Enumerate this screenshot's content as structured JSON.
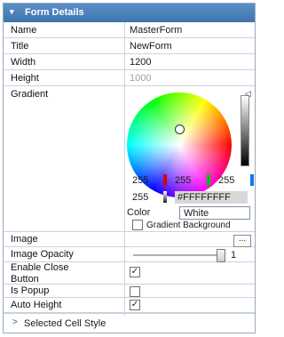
{
  "header": {
    "title": "Form Details",
    "chevron": "▾"
  },
  "rows": {
    "name": {
      "label": "Name",
      "value": "MasterForm"
    },
    "title": {
      "label": "Title",
      "value": "NewForm"
    },
    "width": {
      "label": "Width",
      "value": "1200"
    },
    "height": {
      "label": "Height",
      "value": "1000"
    },
    "gradient": {
      "label": "Gradient"
    },
    "image": {
      "label": "Image",
      "browse": "..."
    },
    "image_opacity": {
      "label": "Image Opacity",
      "value": "1"
    },
    "enable_close": {
      "label": "Enable Close Button",
      "checked": true
    },
    "is_popup": {
      "label": "Is Popup",
      "checked": false
    },
    "auto_height": {
      "label": "Auto Height",
      "checked": true
    }
  },
  "color_picker": {
    "r1": "255",
    "g1": "255",
    "b1": "255",
    "a": "255",
    "hex": "#FFFFFFFF",
    "color_label": "Color",
    "color_value": "White",
    "gradient_background_label": "Gradient Background",
    "gradient_background_checked": false,
    "swatch_red": "#e00000",
    "swatch_green": "#00c000",
    "swatch_blue": "#1a73e8",
    "swatch_alpha": "#222222"
  },
  "footer": {
    "label": "Selected Cell Style",
    "chevron": ">"
  },
  "check_mark": "✓"
}
